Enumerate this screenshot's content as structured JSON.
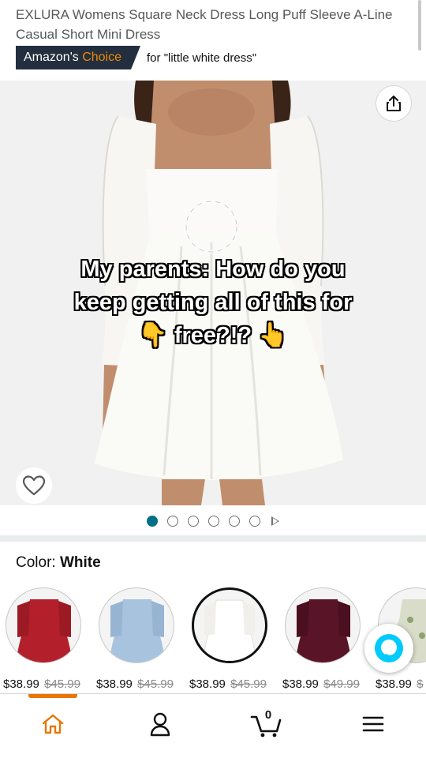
{
  "header": {
    "title": "EXLURA Womens Square Neck Dress Long Puff Sleeve A-Line Casual Short Mini Dress",
    "badge_prefix": "Amazon's ",
    "badge_highlight": "Choice",
    "badge_for": "for \"little white dress\""
  },
  "image": {
    "caption_line1": "My parents: How do you",
    "caption_line2": "keep getting all of this for",
    "caption_line3": "free?!?",
    "caption_emoji_left": "👇",
    "caption_emoji_right": "👆",
    "share_icon": "share-icon",
    "wishlist_icon": "heart-icon",
    "carousel": {
      "total": 6,
      "current": 1
    }
  },
  "color": {
    "label": "Color: ",
    "value": "White"
  },
  "swatches": [
    {
      "color": "#b3202b",
      "price": "$38.99",
      "old_price": "$45.99"
    },
    {
      "color": "#a8c3de",
      "price": "$38.99",
      "old_price": "$45.99"
    },
    {
      "color": "#f5f4f0",
      "price": "$38.99",
      "old_price": "$45.99",
      "selected": true
    },
    {
      "color": "#5a1428",
      "price": "$38.99",
      "old_price": "$49.99"
    },
    {
      "color": "#c9cfb8",
      "price": "$38.99",
      "old_price": "$"
    }
  ],
  "nav": {
    "items": [
      "home-icon",
      "account-icon",
      "cart-icon",
      "menu-icon"
    ],
    "cart_count": "0",
    "active_color": "#e77600"
  },
  "colors": {
    "badge_bg": "#232f3e",
    "badge_choice": "#f08804",
    "dot_active": "#007185",
    "alexa": "#00caff"
  }
}
